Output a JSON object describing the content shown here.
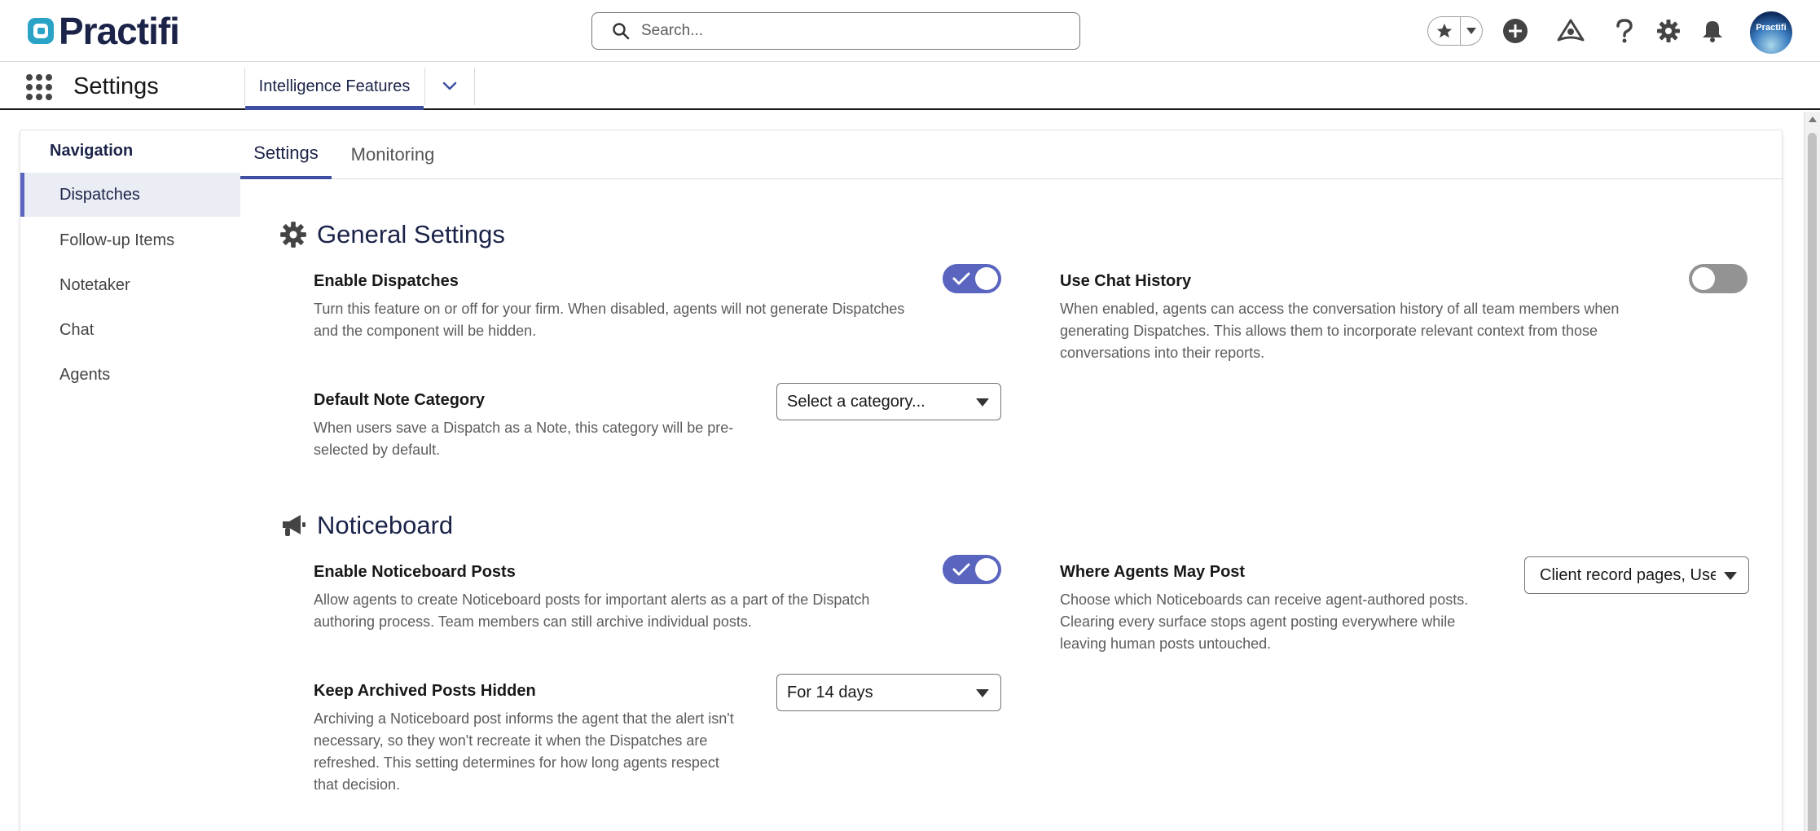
{
  "header": {
    "logo_text": "Practifi",
    "search_placeholder": "Search...",
    "avatar_text": "Practifi",
    "icons": [
      "favorites-star-icon",
      "favorites-caret-icon",
      "add-icon",
      "trailhead-icon",
      "help-icon",
      "setup-gear-icon",
      "notifications-bell-icon"
    ]
  },
  "app_nav": {
    "app_name": "Settings",
    "active_tab": "Intelligence Features"
  },
  "side_nav": {
    "title": "Navigation",
    "items": [
      {
        "label": "Dispatches",
        "active": true
      },
      {
        "label": "Follow-up Items",
        "active": false
      },
      {
        "label": "Notetaker",
        "active": false
      },
      {
        "label": "Chat",
        "active": false
      },
      {
        "label": "Agents",
        "active": false
      }
    ]
  },
  "sub_tabs": [
    {
      "label": "Settings",
      "active": true
    },
    {
      "label": "Monitoring",
      "active": false
    }
  ],
  "sections": {
    "general": {
      "title": "General Settings",
      "enable_dispatches": {
        "label": "Enable Dispatches",
        "desc_line1": "Turn this feature on or off for your firm. When disabled, agents will not generate Dispatches",
        "desc_line2": "and the component will be hidden.",
        "enabled": true
      },
      "use_chat_history": {
        "label": "Use Chat History",
        "desc_line1": "When enabled, agents can access the conversation history of all team members when",
        "desc_line2": "generating Dispatches. This allows them to incorporate relevant context from those",
        "desc_line3": "conversations into their reports.",
        "enabled": false
      },
      "default_note_category": {
        "label": "Default Note Category",
        "desc_line1": "When users save a Dispatch as a Note, this category will be pre-",
        "desc_line2": "selected by default.",
        "value": "Select a category..."
      }
    },
    "noticeboard": {
      "title": "Noticeboard",
      "enable_posts": {
        "label": "Enable Noticeboard Posts",
        "desc_line1": "Allow agents to create Noticeboard posts for important alerts as a part of the Dispatch",
        "desc_line2": "authoring process. Team members can still archive individual posts.",
        "enabled": true
      },
      "where_agents_post": {
        "label": "Where Agents May Post",
        "desc_line1": "Choose which Noticeboards can receive agent-authored posts.",
        "desc_line2": "Clearing every surface stops agent posting everywhere while",
        "desc_line3": "leaving human posts untouched.",
        "value": "Client record pages, Use"
      },
      "keep_archived_hidden": {
        "label": "Keep Archived Posts Hidden",
        "desc_line1": "Archiving a Noticeboard post informs the agent that the alert isn't",
        "desc_line2": "necessary, so they won't recreate it when the Dispatches are",
        "desc_line3": "refreshed. This setting determines for how long agents respect",
        "desc_line4": "that decision.",
        "value": "For 14 days"
      }
    }
  },
  "colors": {
    "brand_navy": "#1b2349",
    "accent": "#5a65c0",
    "toggle_off": "#939393"
  }
}
